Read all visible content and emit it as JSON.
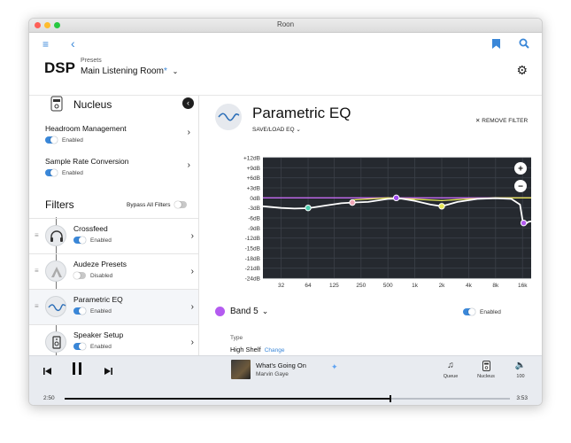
{
  "window": {
    "title": "Roon"
  },
  "header": {
    "title": "DSP",
    "presets_label": "Presets",
    "preset_name": "Main Listening Room",
    "preset_modified_mark": "*"
  },
  "sidebar": {
    "device_name": "Nucleus",
    "settings": [
      {
        "title": "Headroom Management",
        "status": "Enabled",
        "enabled": true
      },
      {
        "title": "Sample Rate Conversion",
        "status": "Enabled",
        "enabled": true
      }
    ],
    "filters_title": "Filters",
    "bypass_label": "Bypass All Filters",
    "filters": [
      {
        "name": "Crossfeed",
        "status": "Enabled",
        "enabled": true,
        "icon": "headphones-icon"
      },
      {
        "name": "Audeze Presets",
        "status": "Disabled",
        "enabled": false,
        "icon": "audeze-logo-icon"
      },
      {
        "name": "Parametric EQ",
        "status": "Enabled",
        "enabled": true,
        "icon": "eq-curve-icon",
        "active": true
      },
      {
        "name": "Speaker Setup",
        "status": "Enabled",
        "enabled": true,
        "icon": "speaker-icon"
      }
    ]
  },
  "main": {
    "title": "Parametric EQ",
    "save_load": "SAVE/LOAD EQ",
    "remove_filter": "REMOVE FILTER",
    "band_label": "Band 5",
    "band_status": "Enabled",
    "type_label": "Type",
    "type_value": "High Shelf",
    "type_change": "Change",
    "graph_zoom_in": "+",
    "graph_zoom_out": "−"
  },
  "chart_data": {
    "type": "line",
    "xscale": "log",
    "x_ticks": [
      "32",
      "64",
      "125",
      "250",
      "500",
      "1k",
      "2k",
      "4k",
      "8k",
      "16k"
    ],
    "y_ticks": [
      "+12dB",
      "+9dB",
      "+6dB",
      "+3dB",
      "0dB",
      "-3dB",
      "-6dB",
      "-9dB",
      "-12dB",
      "-15dB",
      "-18dB",
      "-21dB",
      "-24dB"
    ],
    "ylim": [
      -24,
      12
    ],
    "xlim": [
      20,
      20000
    ],
    "grid": true,
    "series": [
      {
        "style": "response-curve",
        "color": "#ffffff",
        "x": [
          20,
          32,
          45,
          64,
          100,
          150,
          200,
          300,
          500,
          700,
          1000,
          1500,
          2000,
          3000,
          5000,
          8000,
          12000,
          15000,
          16000,
          17000,
          18500,
          20000
        ],
        "y": [
          -2.5,
          -3.0,
          -3.2,
          -3.1,
          -2.3,
          -1.6,
          -1.4,
          -1.2,
          -0.3,
          -0.2,
          -0.9,
          -2.0,
          -2.5,
          -1.2,
          -0.3,
          -0.1,
          -0.3,
          -2.0,
          -6.5,
          -8.0,
          -7.2,
          -7.0
        ]
      },
      {
        "style": "band-5-shelf",
        "color": "#e8e85a",
        "x": [
          200,
          500,
          1000,
          2000,
          4000,
          8000,
          12000,
          15000,
          16000,
          17000,
          20000
        ],
        "y": [
          -0.6,
          0,
          -0.4,
          -0.8,
          -0.3,
          0,
          0,
          0,
          0,
          0,
          0
        ]
      },
      {
        "style": "flat",
        "color": "#c46af2",
        "x": [
          20,
          20000
        ],
        "y": [
          0,
          0
        ]
      }
    ],
    "bands": [
      {
        "x": 64,
        "y": -3.0,
        "color": "#4fcfb0"
      },
      {
        "x": 200,
        "y": -1.4,
        "color": "#f0a8b8"
      },
      {
        "x": 620,
        "y": 0.0,
        "color": "#a24df0"
      },
      {
        "x": 2000,
        "y": -2.5,
        "color": "#e8e85a"
      },
      {
        "x": 16500,
        "y": -7.5,
        "color": "#b45bf0"
      }
    ]
  },
  "player": {
    "song": "What's Going On",
    "artist": "Marvin Gaye",
    "elapsed": "2:50",
    "total": "3:53",
    "progress": 0.73,
    "queue_label": "Queue",
    "zone_label": "Nucleus",
    "volume": "100"
  }
}
